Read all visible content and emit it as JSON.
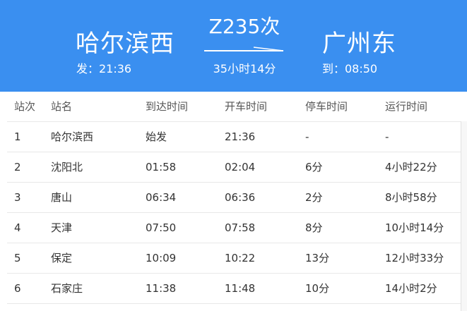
{
  "header": {
    "from_station": "哈尔滨西",
    "from_time": "发：21:36",
    "train_number": "Z235次",
    "duration": "35小时14分",
    "to_station": "广州东",
    "to_time": "到：08:50",
    "background_color": "#3a8ff0"
  },
  "table": {
    "columns": [
      "站次",
      "站名",
      "到达时间",
      "开车时间",
      "停车时间",
      "运行时间"
    ],
    "rows": [
      [
        "1",
        "哈尔滨西",
        "始发",
        "21:36",
        "-",
        "-"
      ],
      [
        "2",
        "沈阳北",
        "01:58",
        "02:04",
        "6分",
        "4小时22分"
      ],
      [
        "3",
        "唐山",
        "06:34",
        "06:36",
        "2分",
        "8小时58分"
      ],
      [
        "4",
        "天津",
        "07:50",
        "07:58",
        "8分",
        "10小时14分"
      ],
      [
        "5",
        "保定",
        "10:09",
        "10:22",
        "13分",
        "12小时33分"
      ],
      [
        "6",
        "石家庄",
        "11:38",
        "11:48",
        "10分",
        "14小时2分"
      ]
    ]
  }
}
